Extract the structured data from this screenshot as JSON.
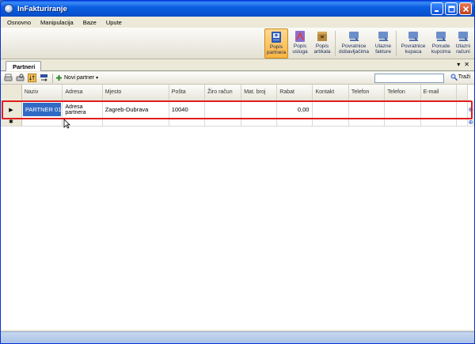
{
  "window": {
    "title": "InFakturiranje"
  },
  "menu": [
    "Osnovno",
    "Manipulacija",
    "Baze",
    "Upute"
  ],
  "ribbon": [
    {
      "id": "popis-partnera",
      "line1": "Popis",
      "line2": "partnera",
      "icon": "address-book-icon",
      "active": true
    },
    {
      "id": "popis-usluga",
      "line1": "Popis",
      "line2": "usluga",
      "icon": "services-icon",
      "active": false
    },
    {
      "id": "popis-artikala",
      "line1": "Popis",
      "line2": "artikala",
      "icon": "articles-icon",
      "active": false
    },
    {
      "id": "povratnice-dobavljacima",
      "line1": "Povratnice",
      "line2": "dobavljačima",
      "icon": "return-icon",
      "active": false
    },
    {
      "id": "ulazne-fakture",
      "line1": "Ulazne",
      "line2": "fakture",
      "icon": "invoice-in-icon",
      "active": false
    },
    {
      "id": "povratnice-kupaca",
      "line1": "Povratnice",
      "line2": "kupaca",
      "icon": "return-icon",
      "active": false
    },
    {
      "id": "ponude-kupcima",
      "line1": "Ponude",
      "line2": "kupcima",
      "icon": "offer-icon",
      "active": false
    },
    {
      "id": "izlazni-racuni",
      "line1": "Izlazni",
      "line2": "računi",
      "icon": "invoice-out-icon",
      "active": false
    }
  ],
  "tab": {
    "label": "Partneri",
    "pin": "▾",
    "close": "✕"
  },
  "toolbar": {
    "new_partner": "Novi partner",
    "search_button": "Traži",
    "search_value": ""
  },
  "grid": {
    "columns": [
      {
        "label": "Naziv"
      },
      {
        "label": "Adresa"
      },
      {
        "label": "Mjesto"
      },
      {
        "label": "Pošta"
      },
      {
        "label": "Žiro račun"
      },
      {
        "label": "Mat. broj"
      },
      {
        "label": "Rabat"
      },
      {
        "label": "Kontakt"
      },
      {
        "label": "Telefon"
      },
      {
        "label": "Telefon"
      },
      {
        "label": "E-mail"
      }
    ],
    "rows": [
      {
        "naziv": "PARTNER 01",
        "adresa": "Adresa partnera",
        "mjesto": "Zagreb-Dubrava",
        "posta": "10040",
        "ziro": "",
        "mat": "",
        "rabat": "0,00",
        "kontakt": "",
        "telefon1": "",
        "telefon2": "",
        "email": ""
      }
    ]
  },
  "colors": {
    "highlight": "#e01e1e",
    "selection": "#316ac5",
    "accent": "#0a5ae7"
  }
}
